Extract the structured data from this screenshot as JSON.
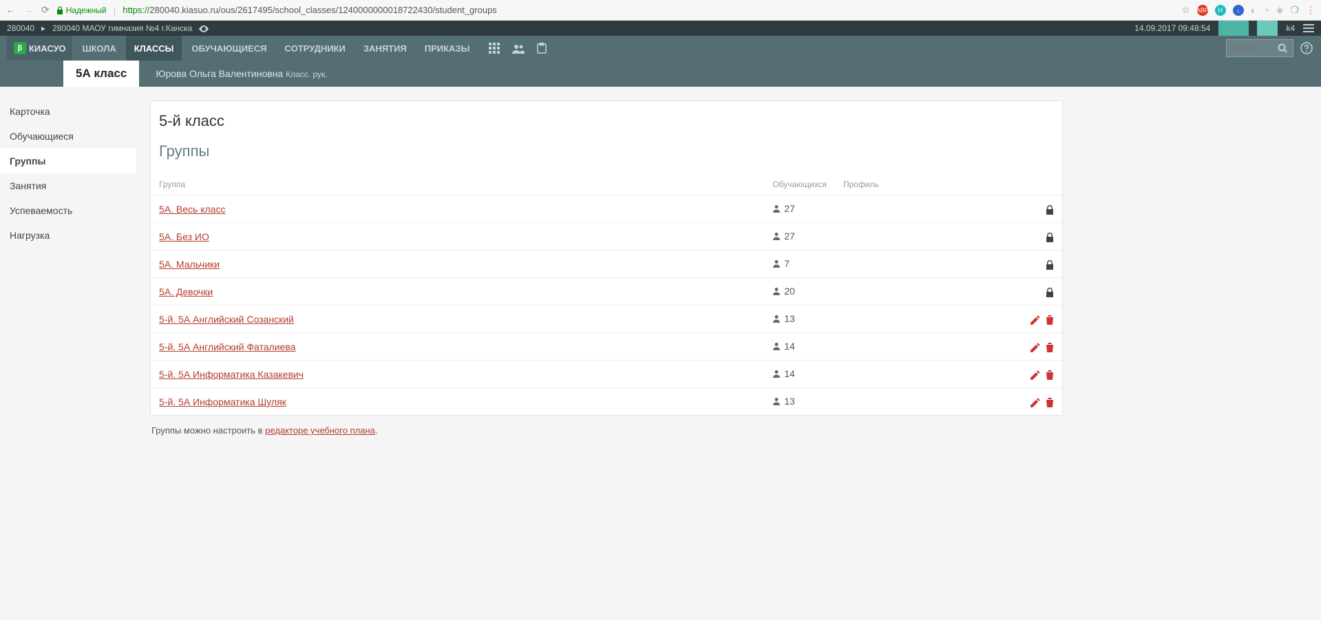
{
  "browser": {
    "secure_label": "Надежный",
    "url_prefix": "https://",
    "url_rest": "280040.kiasuo.ru/ous/2617495/school_classes/1240000000018722430/student_groups"
  },
  "topbar": {
    "code": "280040",
    "school": "280040 МАОУ гимназия №4 г.Канска",
    "datetime": "14.09.2017 09:48:54",
    "user": "k4"
  },
  "brand": {
    "beta": "β",
    "name": "КИАСУО"
  },
  "nav": {
    "items": [
      "ШКОЛА",
      "КЛАССЫ",
      "ОБУЧАЮЩИЕСЯ",
      "СОТРУДНИКИ",
      "ЗАНЯТИЯ",
      "ПРИКАЗЫ"
    ],
    "active_index": 1,
    "search_placeholder": "Поиск"
  },
  "subheader": {
    "class_label": "5А класс",
    "teacher": "Юрова Ольга Валентиновна",
    "teacher_role": "Класс. рук."
  },
  "sidebar": {
    "items": [
      "Карточка",
      "Обучающиеся",
      "Группы",
      "Занятия",
      "Успеваемость",
      "Нагрузка"
    ],
    "active_index": 2
  },
  "page": {
    "title": "5-й класс",
    "section": "Группы",
    "columns": {
      "group": "Группа",
      "count": "Обучающихся",
      "profile": "Профиль"
    },
    "rows": [
      {
        "name": "5А. Весь класс",
        "count": 27,
        "locked": true
      },
      {
        "name": "5А. Без ИО",
        "count": 27,
        "locked": true
      },
      {
        "name": "5А. Мальчики",
        "count": 7,
        "locked": true
      },
      {
        "name": "5А. Девочки",
        "count": 20,
        "locked": true
      },
      {
        "name": "5-й. 5А Английский Созанский",
        "count": 13,
        "locked": false
      },
      {
        "name": "5-й. 5А Английский Фаталиева",
        "count": 14,
        "locked": false
      },
      {
        "name": "5-й. 5А Информатика Казакевич",
        "count": 14,
        "locked": false
      },
      {
        "name": "5-й. 5А Информатика Шуляк",
        "count": 13,
        "locked": false
      }
    ],
    "footnote_prefix": "Группы можно настроить в ",
    "footnote_link": "редакторе учебного плана",
    "footnote_suffix": "."
  }
}
